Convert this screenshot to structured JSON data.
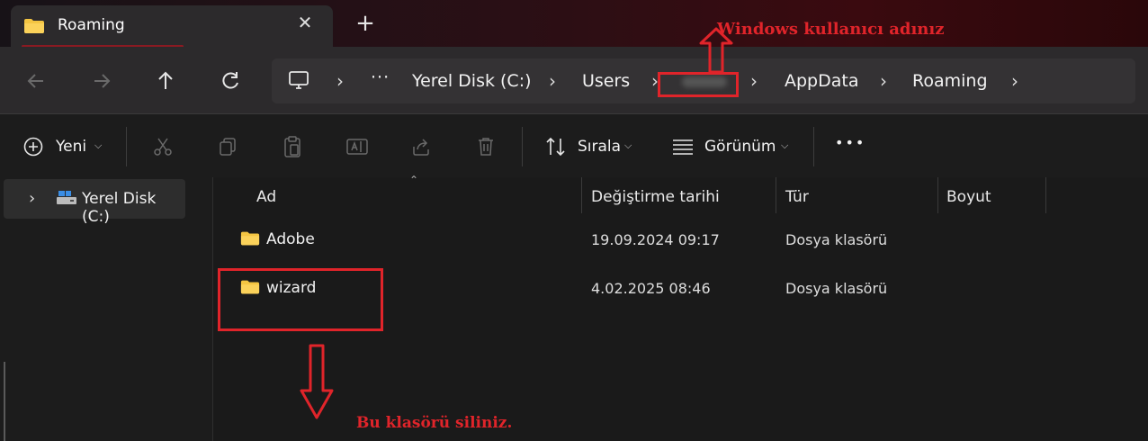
{
  "tab": {
    "title": "Roaming",
    "close_glyph": "✕",
    "new_glyph": "+"
  },
  "nav": {
    "back": "back-arrow-icon",
    "forward": "forward-arrow-icon",
    "up": "up-arrow-icon",
    "refresh": "refresh-icon"
  },
  "breadcrumb": {
    "more": "···",
    "items": [
      "Yerel Disk (C:)",
      "Users",
      "AppData",
      "Roaming"
    ],
    "separator": "›"
  },
  "toolbar": {
    "new_label": "Yeni",
    "sort_label": "Sırala",
    "view_label": "Görünüm",
    "more": "•••"
  },
  "sidebar": {
    "items": [
      {
        "label": "Yerel Disk (C:)"
      }
    ]
  },
  "columns": {
    "name": "Ad",
    "date": "Değiştirme tarihi",
    "type": "Tür",
    "size": "Boyut"
  },
  "files": [
    {
      "name": "Adobe",
      "date": "19.09.2024 09:17",
      "type": "Dosya klasörü",
      "size": ""
    },
    {
      "name": "wizard",
      "date": "4.02.2025 08:46",
      "type": "Dosya klasörü",
      "size": ""
    }
  ],
  "annotations": {
    "username_note": "Windows kullanıcı adınız",
    "delete_note": "Bu klasörü siliniz."
  },
  "colors": {
    "annotation_red": "#e0242a",
    "folder_yellow": "#f4c542"
  }
}
